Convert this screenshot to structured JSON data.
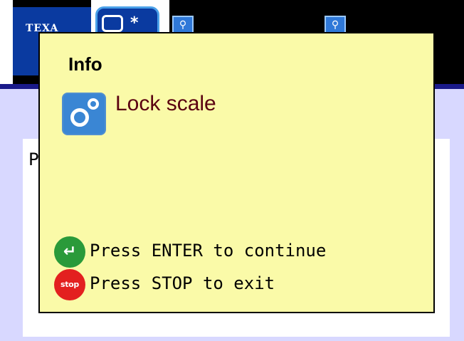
{
  "background": {
    "logo_text": "TEXA",
    "panel_label_partial": "P",
    "tool_icon_labels": [
      "⚲",
      "⚲"
    ]
  },
  "dialog": {
    "title": "Info",
    "message": "Lock scale",
    "icon": "gears-icon",
    "hints": [
      {
        "icon": "enter-icon",
        "badge_text": "↵",
        "text": "Press ENTER to continue",
        "color": "#2a9a3a"
      },
      {
        "icon": "stop-icon",
        "badge_text": "stop",
        "text": "Press STOP to exit",
        "color": "#e3201f"
      }
    ]
  }
}
